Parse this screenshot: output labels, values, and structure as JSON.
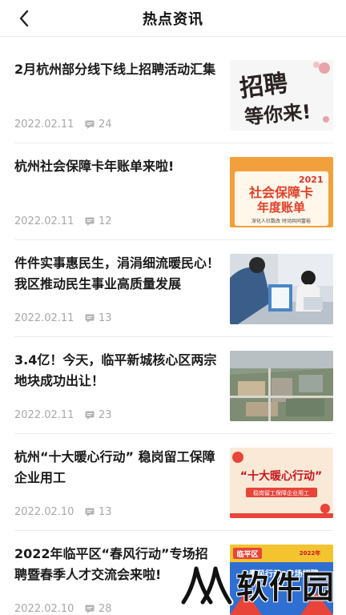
{
  "header": {
    "title": "热点资讯",
    "back_icon": "chevron-left-icon"
  },
  "articles": [
    {
      "title": "2月杭州部分线下线上招聘活动汇集",
      "date": "2022.02.11",
      "comments": "24",
      "thumb": {
        "line1": "招聘",
        "line2": "等你来!"
      }
    },
    {
      "title": "杭州社会保障卡年账单来啦!",
      "date": "2022.02.11",
      "comments": "12",
      "thumb": {
        "year": "2021",
        "line1": "社会保障卡",
        "line2": "年度账单",
        "footer": "深化人社数改  时动共同富裕"
      }
    },
    {
      "title": "件件实事惠民生，涓涓细流暖民心！我区推动民生事业高质量发展",
      "date": "2022.02.11",
      "comments": "13",
      "thumb": {
        "kind": "office-photo"
      }
    },
    {
      "title": "3.4亿！今天，临平新城核心区两宗地块成功出让！",
      "date": "2022.02.11",
      "comments": "23",
      "thumb": {
        "kind": "aerial-photo"
      }
    },
    {
      "title": "杭州“十大暖心行动” 稳岗留工保障企业用工",
      "date": "2022.02.10",
      "comments": "13",
      "thumb": {
        "line1": "“十大暖心行动”",
        "line2": "稳岗留工保障企业用工"
      }
    },
    {
      "title": "2022年临平区“春风行动”专场招聘暨春季人才交流会来啦!",
      "date": "2022.02.10",
      "comments": "28",
      "thumb": {
        "tag": "临平区",
        "year": "2022年",
        "line1": "“春风行动”专场招聘"
      }
    }
  ],
  "watermark": {
    "text": "软件园"
  },
  "colors": {
    "accent_red": "#c8161d",
    "meta_gray": "#a8a8a8",
    "divider": "#ececec"
  }
}
